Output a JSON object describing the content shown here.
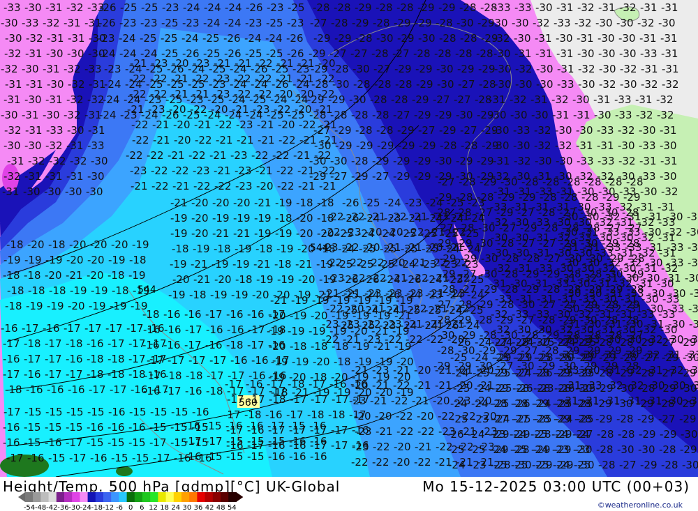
{
  "title_left": "Height/Temp. 500 hPa [gdmp][°C] UK-Global",
  "title_right": "Mo 15-12-2025 03:00 UTC (00+03)",
  "credit": "©weatheronline.co.uk",
  "height_labels": [
    "544",
    "544",
    "560"
  ],
  "legend": {
    "ticks": [
      "-54",
      "-48",
      "-42",
      "-36",
      "-30",
      "-24",
      "-18",
      "-12",
      "-6",
      "0",
      "6",
      "12",
      "18",
      "24",
      "30",
      "36",
      "42",
      "48",
      "54"
    ],
    "colors": [
      "#7a7a7a",
      "#9a9a9a",
      "#bdbdbd",
      "#dcdcdc",
      "#7b1f8c",
      "#b52ec0",
      "#e043e6",
      "#f58af5",
      "#1414b4",
      "#2a3cdc",
      "#3c64f0",
      "#3c96ff",
      "#28c8ff",
      "#0a6e0a",
      "#14a014",
      "#1ec81e",
      "#28e628",
      "#e8e800",
      "#ffff50",
      "#ffd200",
      "#ffa000",
      "#ff7800",
      "#e60000",
      "#b40000",
      "#8a0000",
      "#5a0000",
      "#280000"
    ]
  },
  "palette": {
    "land_gray": "#ececec",
    "land_green": "#c6f0b4",
    "t_minus30": "#f58af5",
    "t_minus28": "#1a12b8",
    "t_minus24": "#2a3cdc",
    "t_minus22": "#3c78f5",
    "t_minus20": "#3ca4ff",
    "t_minus18": "#28d2ff",
    "t_minus16": "#18f0ff",
    "green_patch": "#1e781e"
  },
  "map_numbers": {
    "minus30": [
      "-30",
      "-31",
      "-32",
      "-33",
      "-31",
      "-30"
    ],
    "minus28": [
      "-28",
      "-29",
      "-28",
      "-27",
      "-29",
      "-30"
    ],
    "minus24": [
      "-24",
      "-25",
      "-26",
      "-23",
      "-25",
      "-24"
    ],
    "minus22": [
      "-22",
      "-21",
      "-20",
      "-22",
      "-21",
      "-23"
    ],
    "minus19": [
      "-19",
      "-20",
      "-18",
      "-19",
      "-20",
      "-21"
    ],
    "minus17": [
      "-17",
      "-16",
      "-17",
      "-18",
      "-16",
      "-17"
    ],
    "minus15": [
      "-15",
      "-16",
      "-15",
      "-17",
      "-16",
      "-15"
    ]
  }
}
